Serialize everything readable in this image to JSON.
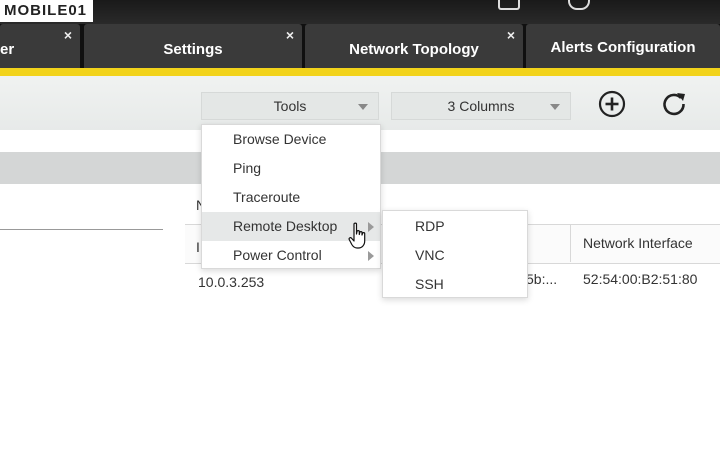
{
  "watermark": {
    "text": "MOBILE01"
  },
  "tabs": [
    {
      "label": "er",
      "close": "×"
    },
    {
      "label": "Settings",
      "close": "×"
    },
    {
      "label": "Network Topology",
      "close": "×"
    },
    {
      "label": "Alerts Configuration"
    }
  ],
  "toolbar": {
    "tools_select": "Tools",
    "columns_select": "3 Columns",
    "add_icon": "plus-circle-icon",
    "refresh_icon": "refresh-icon"
  },
  "table": {
    "partial_header_top": "N",
    "partial_header_col1": "I",
    "header_network_interface": "Network Interface",
    "row": {
      "ip": "10.0.3.253",
      "partial_mac": "5b:...",
      "network_interface": "52:54:00:B2:51:80"
    }
  },
  "tools_menu": {
    "items": [
      "Browse Device",
      "Ping",
      "Traceroute",
      "Remote Desktop",
      "Power Control"
    ]
  },
  "remote_desktop_submenu": {
    "items": [
      "RDP",
      "VNC",
      "SSH"
    ]
  },
  "colors": {
    "accent": "#f2d31b",
    "tab_bg": "#3a3a3a",
    "tabstrip_bg": "#101010",
    "menu_highlight": "#e6e8e8"
  }
}
